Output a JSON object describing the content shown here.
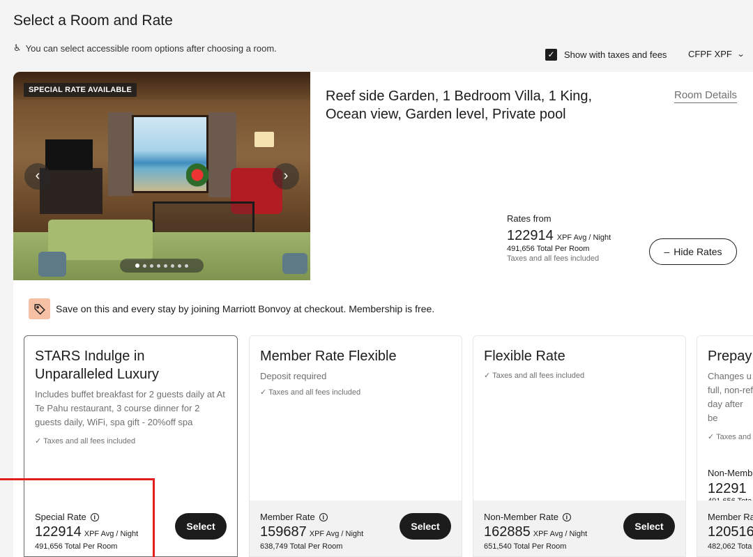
{
  "page": {
    "title": "Select a Room and Rate",
    "accessibility_note": "You can select accessible room options after choosing a room."
  },
  "controls": {
    "taxes_checkbox_label": "Show with taxes and fees",
    "taxes_checked": true,
    "currency": "CFPF XPF"
  },
  "room": {
    "badge": "SPECIAL RATE AVAILABLE",
    "title": "Reef side Garden, 1 Bedroom Villa, 1 King, Ocean view, Garden level, Private pool",
    "details_link": "Room Details",
    "carousel": {
      "total_images": 8,
      "active_index": 0
    },
    "rates_from": {
      "label": "Rates from",
      "price": "122914",
      "unit": "XPF Avg / Night",
      "total": "491,656 Total Per Room",
      "taxes": "Taxes and all fees included"
    },
    "hide_rates_label": "Hide Rates",
    "hide_rates_symbol": "–"
  },
  "promo": {
    "text": "Save on this and every stay by joining Marriott Bonvoy at checkout. Membership is free."
  },
  "rates": [
    {
      "name": "STARS Indulge in Unparalleled Luxury",
      "description": "Includes buffet breakfast for 2 guests daily at At Te Pahu restaurant, 3 course dinner for 2 guests daily, WiFi, spa gift - 20%off spa",
      "check": "✓ Taxes and all fees included",
      "rate_type": "Special Rate",
      "price": "122914",
      "unit": "XPF Avg / Night",
      "total": "491,656 Total Per Room",
      "button": "Select"
    },
    {
      "name": "Member Rate Flexible",
      "description": "Deposit required",
      "check": "✓ Taxes and all fees included",
      "rate_type": "Member Rate",
      "price": "159687",
      "unit": "XPF Avg / Night",
      "total": "638,749 Total Per Room",
      "button": "Select"
    },
    {
      "name": "Flexible Rate",
      "description": "",
      "check": "✓ Taxes and all fees included",
      "rate_type": "Non-Member Rate",
      "price": "162885",
      "unit": "XPF Avg / Night",
      "total": "651,540 Total Per Room",
      "button": "Select"
    },
    {
      "name": "Prepay",
      "description": "Changes u full, non-ref day after be",
      "check": "✓ Taxes and",
      "sub_type": "Non-Memb",
      "sub_price": "12291",
      "sub_total": "491,656 Tota",
      "rate_type": "Member Ra",
      "price": "120516",
      "total": "482,062 Tota"
    }
  ]
}
